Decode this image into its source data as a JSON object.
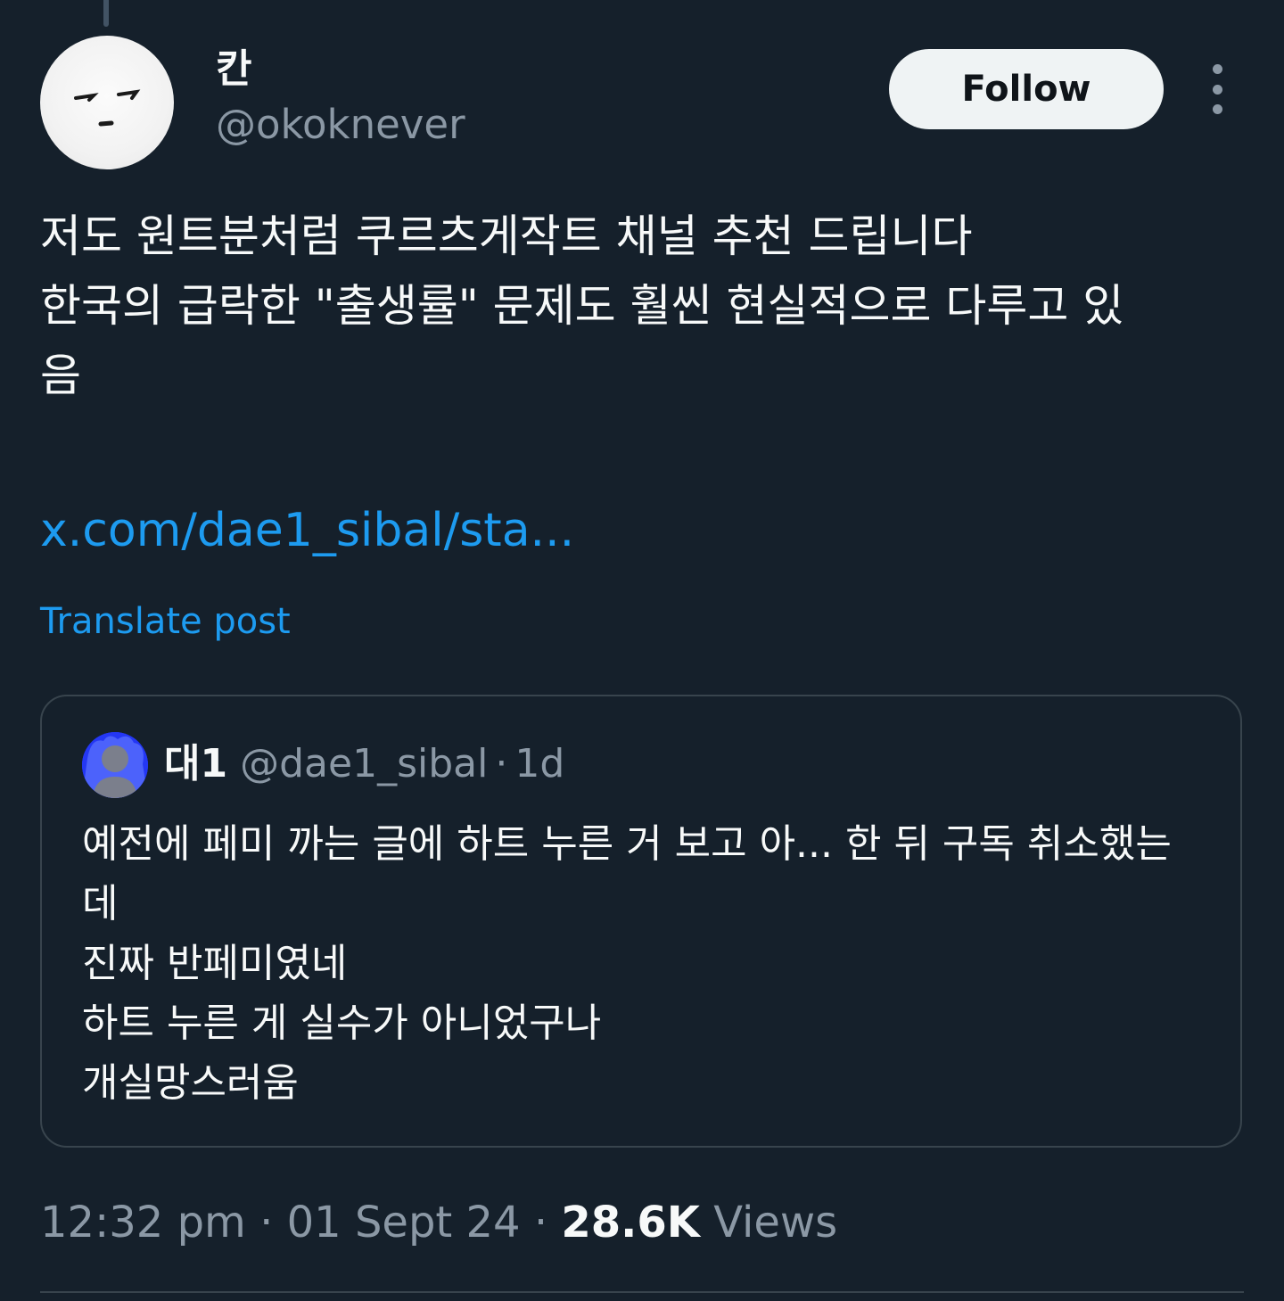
{
  "author": {
    "display_name": "칸",
    "handle": "@okoknever",
    "follow_label": "Follow",
    "more_icon": "more-vertical-icon"
  },
  "post": {
    "text_lines": [
      "저도 원트분처럼 쿠르츠게작트 채널 추천 드립니다",
      "한국의 급락한 \"출생률\" 문제도 훨씬 현실적으로 다루고 있",
      "음"
    ],
    "link": "x.com/dae1_sibal/sta...",
    "translate_label": "Translate post"
  },
  "quote": {
    "display_name": "대1",
    "handle": "@dae1_sibal",
    "separator": "·",
    "time": "1d",
    "text_lines": [
      "예전에 페미 까는 글에 하트 누른 거 보고 아... 한 뒤 구독 취소했는",
      "데",
      "진짜 반페미였네",
      "하트 누른 게 실수가 아니었구나",
      "개실망스러움"
    ]
  },
  "meta": {
    "time": "12:32 pm",
    "separator": "·",
    "date": "01 Sept 24",
    "views_count": "28.6K",
    "views_label": "Views"
  },
  "colors": {
    "background": "#15202b",
    "text": "#f7f9f9",
    "secondary": "#8b98a5",
    "accent": "#1d9bf0",
    "border": "#38444d"
  }
}
